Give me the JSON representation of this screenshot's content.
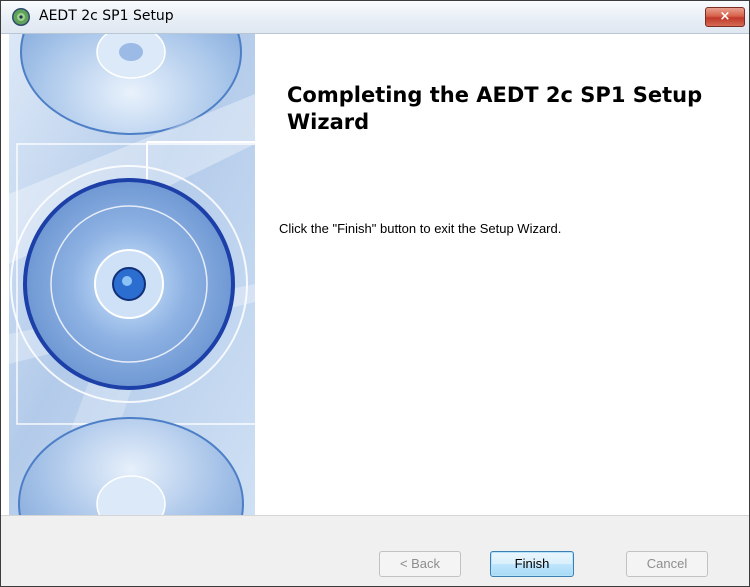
{
  "window": {
    "title": "AEDT 2c SP1 Setup",
    "close_label": "×"
  },
  "wizard": {
    "heading": "Completing the AEDT 2c SP1 Setup Wizard",
    "message": "Click the \"Finish\" button to exit the Setup Wizard."
  },
  "buttons": {
    "back": {
      "label": "< Back",
      "enabled": false
    },
    "finish": {
      "label": "Finish",
      "enabled": true,
      "default": true
    },
    "cancel": {
      "label": "Cancel",
      "enabled": false
    }
  },
  "icons": {
    "app": "disc-installer-icon",
    "close": "close-icon",
    "banner": "cd-disc-artwork"
  },
  "colors": {
    "banner_blue": "#bcd3ee",
    "close_red": "#c0392b",
    "default_button_border": "#3c7fb1"
  }
}
